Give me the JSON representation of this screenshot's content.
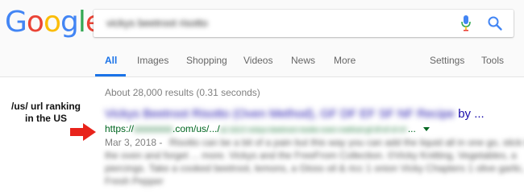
{
  "logo": {
    "text": "Google",
    "letters": [
      "G",
      "o",
      "o",
      "g",
      "l",
      "e"
    ],
    "colors": [
      "#4285F4",
      "#EA4335",
      "#FBBC05",
      "#4285F4",
      "#34A853",
      "#EA4335"
    ]
  },
  "search": {
    "query": "vickys beetroot risotto"
  },
  "tabs": [
    {
      "label": "All",
      "active": true
    },
    {
      "label": "Images"
    },
    {
      "label": "Shopping"
    },
    {
      "label": "Videos"
    },
    {
      "label": "News"
    },
    {
      "label": "More"
    },
    {
      "label": "Settings"
    },
    {
      "label": "Tools"
    }
  ],
  "results_stats": "About 28,000 results (0.31 seconds)",
  "annotation": {
    "line1": "/us/ url ranking",
    "line2": "in the US"
  },
  "result": {
    "title_blurred": "Vickys Beetroot Risotto (Oven Method), GF DF EF SF NF Recipe",
    "title_suffix": "by ...",
    "url_prefix": "https://",
    "url_domain_blurred": "xxxxxxxx",
    "url_visible": ".com/us/.../",
    "url_path_blurred": "a1 b2c3 vickys-beetroot-risotto-oven-method-gf-df-ef-sf-nf-",
    "url_ellipsis": "...",
    "date": "Mar 3, 2018 -",
    "snippet": [
      "Risotto can be a bit of a pain but this way you can add the liquid all in one go, stick it in",
      "the oven and forget ... more. Vickys and the FreeFrom Collection. ©Vicky Knitting, Vegetables, a",
      "piercings. Take a cooked beetroot, lemons, a Gloss oil & ricc 1 onion Vicky Chapters 1 olive garlic,",
      "Fresh Pepper"
    ]
  },
  "colors": {
    "accent": "#1a73e8",
    "link": "#1a0dab",
    "url": "#006621",
    "arrow": "#e8231b"
  },
  "icons": [
    "mic-icon",
    "search-icon",
    "arrow-right-icon",
    "dropdown-caret-icon"
  ]
}
